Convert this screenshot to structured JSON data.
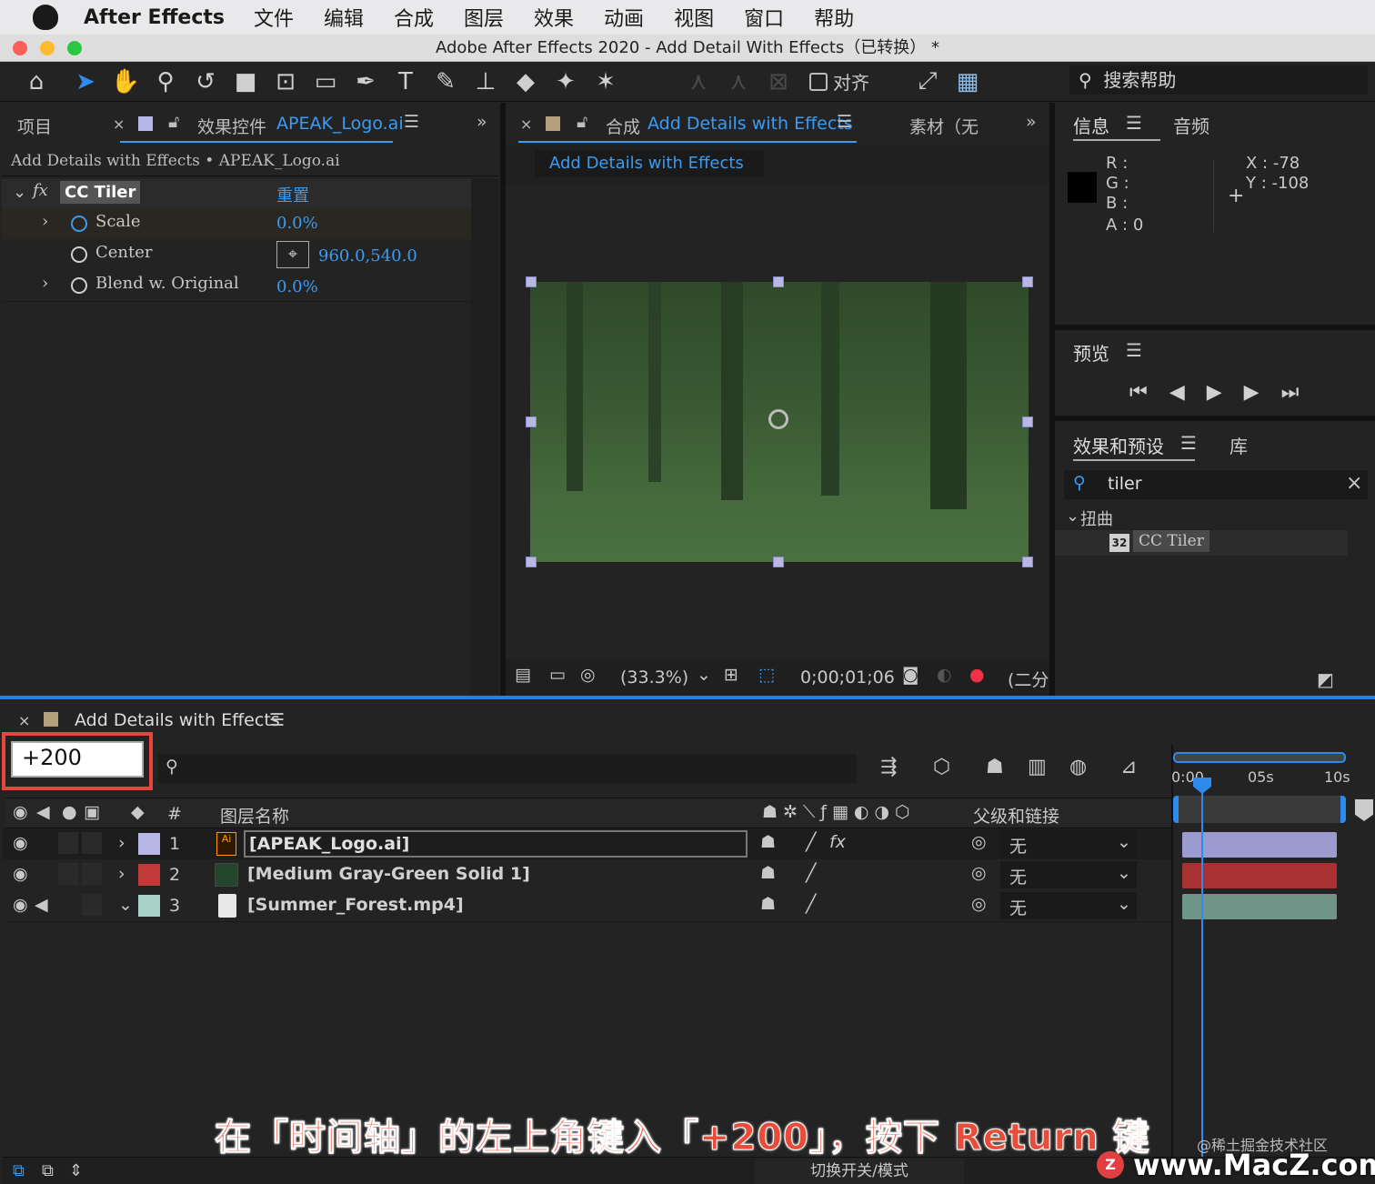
{
  "menu": {
    "app": "After Effects",
    "items": [
      "文件",
      "编辑",
      "合成",
      "图层",
      "效果",
      "动画",
      "视图",
      "窗口",
      "帮助"
    ]
  },
  "window": {
    "title": "Adobe After Effects 2020 - Add Detail With Effects（已转换） *"
  },
  "toolbar": {
    "align_label": "对齐",
    "search_help": "搜索帮助"
  },
  "effects_panel": {
    "tab_project": "项目",
    "tab_label": "效果控件",
    "tab_target": "APEAK_Logo.ai",
    "breadcrumb": "Add Details with Effects • APEAK_Logo.ai",
    "effect_name": "CC Tiler",
    "reset": "重置",
    "params": [
      {
        "name": "Scale",
        "value": "0.0%"
      },
      {
        "name": "Center",
        "value": "960.0,540.0"
      },
      {
        "name": "Blend w. Original",
        "value": "0.0%"
      }
    ]
  },
  "comp_panel": {
    "tab_label": "合成",
    "tab_target": "Add Details with Effects",
    "tab_footage": "素材（无",
    "subtab": "Add Details with Effects",
    "zoom": "(33.3%)",
    "timecode": "0;00;01;06",
    "resolution": "(二分"
  },
  "info_panel": {
    "tab_info": "信息",
    "tab_audio": "音频",
    "r": "R :",
    "g": "G :",
    "b": "B :",
    "a": "A :  0",
    "x": "X : -78",
    "y": "Y : -108"
  },
  "preview_panel": {
    "title": "预览"
  },
  "effects_presets": {
    "tab": "效果和预设",
    "tab_lib": "库",
    "search": "tiler",
    "category": "扭曲",
    "item": "CC Tiler",
    "item_badge": "32"
  },
  "timeline": {
    "title": "Add Details with Effects",
    "timecode_input": "+200",
    "col_layer_name": "图层名称",
    "col_hash": "#",
    "col_parent": "父级和链接",
    "ruler": [
      "0:00",
      "05s",
      "10s"
    ],
    "footer": "切换开关/模式",
    "layers": [
      {
        "num": "1",
        "name": "[APEAK_Logo.ai]",
        "parent": "无",
        "color": "#b7b7e6",
        "bar": "#9b9bd0"
      },
      {
        "num": "2",
        "name": "[Medium Gray-Green Solid 1]",
        "parent": "无",
        "color": "#c33a3a",
        "bar": "#a83232"
      },
      {
        "num": "3",
        "name": "[Summer_Forest.mp4]",
        "parent": "无",
        "color": "#a9d3c8",
        "bar": "#6f9488"
      }
    ]
  },
  "caption": "在「时间轴」的左上角键入「+200」，按下 Return 键",
  "watermark": {
    "site": "www.MacZ.com",
    "community": "@稀土掘金技术社区"
  }
}
